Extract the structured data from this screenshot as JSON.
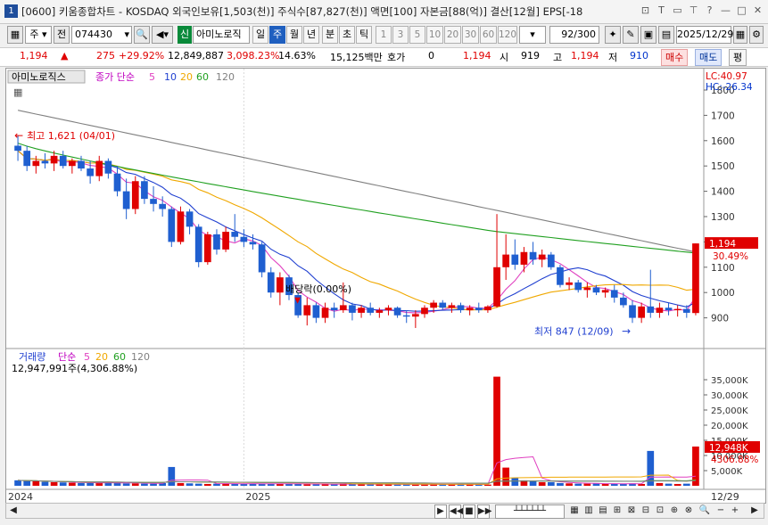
{
  "window": {
    "app_icon": "1",
    "title": "[0600] 키움종합차트 - KOSDAQ 외국인보유[1,503(천)] 주식수[87,827(천)] 액면[100] 자본금[88(억)] 결산[12월] EPS[-18",
    "controls": [
      "⊡",
      "T",
      "▭",
      "⊤",
      "?",
      "—",
      "□",
      "✕"
    ]
  },
  "toolbar": {
    "type_select": "주",
    "type_button": "전",
    "code_value": "074430",
    "tag_new": "신",
    "stock_name": "아미노로직",
    "periods": [
      "일",
      "주",
      "월",
      "년",
      "분",
      "초",
      "틱"
    ],
    "selected_period": "주",
    "minutes": [
      "1",
      "3",
      "5",
      "10",
      "20",
      "30",
      "60",
      "120"
    ],
    "count_value": "92",
    "count_total": "/300",
    "date_value": "2025/12/29"
  },
  "info": {
    "price": "1,194",
    "change": "275",
    "change_rate": "+29.92%",
    "volume": "12,849,887",
    "volume_rate": "3,098.23%",
    "turnover": "14.63%",
    "amount": "15,125백만",
    "quote_label": "호가",
    "quote_value": "0",
    "quote_price": "1,194",
    "open_label": "시",
    "open_value": "919",
    "high_label": "고",
    "high_value": "1,194",
    "low_label": "저",
    "low_value": "910",
    "buy_label": "매수",
    "sell_label": "매도",
    "eval_label": "평"
  },
  "price_panel": {
    "stock_label": "아미노로직스",
    "ma_label": "종가 단순",
    "ma_periods": [
      "5",
      "10",
      "20",
      "60",
      "120"
    ],
    "ma_colors": [
      "#e040c0",
      "#1f3fd0",
      "#f0a800",
      "#20a020",
      "#808080"
    ],
    "lc": "LC:40.97",
    "hc": "HC:-26.34",
    "high_annotation": "최고 1,621 (04/01)",
    "low_annotation": "최저 847 (12/09)",
    "dividend_annotation": "배당락(0.00%)",
    "last_price_tag": "1,194",
    "last_change_tag": "30.49%"
  },
  "volume_panel": {
    "label": "거래량",
    "ma_label": "단순",
    "ma_periods": [
      "5",
      "20",
      "60",
      "120"
    ],
    "ma_colors": [
      "#e040c0",
      "#f0a800",
      "#20a020",
      "#808080"
    ],
    "value_text": "12,947,991주(4,306.88%)",
    "last_volume_tag": "12,948K",
    "last_rate_tag": "4306.88%"
  },
  "x_axis": {
    "labels": [
      "2024",
      "2025"
    ],
    "end_label": "12/29"
  },
  "chart_data": [
    {
      "type": "candlestick",
      "title": "아미노로직스",
      "ylim": [
        800,
        1800
      ],
      "y_ticks": [
        900,
        1000,
        1100,
        1200,
        1300,
        1400,
        1500,
        1600,
        1700,
        1800
      ],
      "ohlc": [
        [
          1580,
          1621,
          1520,
          1560
        ],
        [
          1560,
          1580,
          1480,
          1500
        ],
        [
          1500,
          1540,
          1470,
          1520
        ],
        [
          1520,
          1550,
          1490,
          1510
        ],
        [
          1510,
          1560,
          1480,
          1540
        ],
        [
          1540,
          1560,
          1490,
          1500
        ],
        [
          1500,
          1530,
          1470,
          1520
        ],
        [
          1520,
          1540,
          1480,
          1490
        ],
        [
          1490,
          1520,
          1430,
          1460
        ],
        [
          1460,
          1540,
          1440,
          1520
        ],
        [
          1520,
          1530,
          1450,
          1470
        ],
        [
          1470,
          1500,
          1380,
          1400
        ],
        [
          1400,
          1450,
          1290,
          1330
        ],
        [
          1330,
          1460,
          1310,
          1440
        ],
        [
          1440,
          1460,
          1350,
          1370
        ],
        [
          1370,
          1420,
          1320,
          1350
        ],
        [
          1350,
          1380,
          1300,
          1330
        ],
        [
          1330,
          1340,
          1180,
          1200
        ],
        [
          1200,
          1340,
          1190,
          1320
        ],
        [
          1320,
          1330,
          1230,
          1260
        ],
        [
          1260,
          1270,
          1100,
          1120
        ],
        [
          1120,
          1240,
          1110,
          1230
        ],
        [
          1230,
          1250,
          1150,
          1170
        ],
        [
          1170,
          1260,
          1160,
          1240
        ],
        [
          1240,
          1310,
          1200,
          1220
        ],
        [
          1220,
          1250,
          1180,
          1200
        ],
        [
          1200,
          1230,
          1170,
          1190
        ],
        [
          1190,
          1200,
          1060,
          1080
        ],
        [
          1080,
          1100,
          980,
          1000
        ],
        [
          1000,
          1080,
          950,
          1060
        ],
        [
          1060,
          1070,
          970,
          990
        ],
        [
          990,
          1000,
          900,
          910
        ],
        [
          910,
          980,
          870,
          950
        ],
        [
          950,
          960,
          880,
          900
        ],
        [
          900,
          960,
          880,
          940
        ],
        [
          940,
          960,
          900,
          930
        ],
        [
          930,
          1040,
          920,
          950
        ],
        [
          950,
          960,
          890,
          920
        ],
        [
          920,
          950,
          900,
          940
        ],
        [
          940,
          960,
          910,
          920
        ],
        [
          920,
          940,
          900,
          930
        ],
        [
          930,
          950,
          910,
          940
        ],
        [
          940,
          945,
          900,
          910
        ],
        [
          910,
          930,
          880,
          905
        ],
        [
          905,
          930,
          860,
          915
        ],
        [
          915,
          950,
          900,
          940
        ],
        [
          940,
          970,
          920,
          960
        ],
        [
          960,
          970,
          930,
          940
        ],
        [
          940,
          960,
          920,
          950
        ],
        [
          950,
          960,
          920,
          930
        ],
        [
          930,
          950,
          910,
          940
        ],
        [
          940,
          960,
          920,
          930
        ],
        [
          930,
          950,
          920,
          945
        ],
        [
          945,
          1310,
          940,
          1100
        ],
        [
          1100,
          1230,
          1050,
          1150
        ],
        [
          1150,
          1210,
          1090,
          1110
        ],
        [
          1110,
          1180,
          1080,
          1160
        ],
        [
          1160,
          1200,
          1110,
          1130
        ],
        [
          1130,
          1170,
          1100,
          1150
        ],
        [
          1150,
          1160,
          1090,
          1100
        ],
        [
          1100,
          1110,
          1020,
          1030
        ],
        [
          1030,
          1060,
          1010,
          1040
        ],
        [
          1040,
          1050,
          1000,
          1010
        ],
        [
          1010,
          1040,
          980,
          1020
        ],
        [
          1020,
          1030,
          990,
          1000
        ],
        [
          1000,
          1020,
          980,
          1010
        ],
        [
          1010,
          1030,
          960,
          980
        ],
        [
          980,
          1000,
          940,
          950
        ],
        [
          950,
          970,
          880,
          900
        ],
        [
          900,
          960,
          880,
          945
        ],
        [
          945,
          1090,
          900,
          920
        ],
        [
          920,
          960,
          900,
          940
        ],
        [
          940,
          960,
          910,
          930
        ],
        [
          930,
          950,
          905,
          935
        ],
        [
          935,
          950,
          900,
          920
        ],
        [
          919,
          1194,
          910,
          1194
        ]
      ],
      "volumes_k": [
        1800,
        1600,
        1500,
        1300,
        1200,
        1100,
        1000,
        900,
        900,
        1000,
        1200,
        900,
        800,
        800,
        700,
        700,
        900,
        6200,
        900,
        800,
        700,
        600,
        700,
        800,
        700,
        600,
        700,
        600,
        700,
        600,
        700,
        600,
        500,
        500,
        600,
        500,
        700,
        500,
        500,
        500,
        500,
        500,
        400,
        500,
        400,
        500,
        600,
        400,
        500,
        400,
        400,
        500,
        400,
        36000,
        6000,
        2500,
        1800,
        1500,
        1200,
        1200,
        900,
        800,
        700,
        700,
        800,
        600,
        700,
        600,
        800,
        600,
        11500,
        900,
        700,
        600,
        700,
        12948
      ]
    }
  ]
}
